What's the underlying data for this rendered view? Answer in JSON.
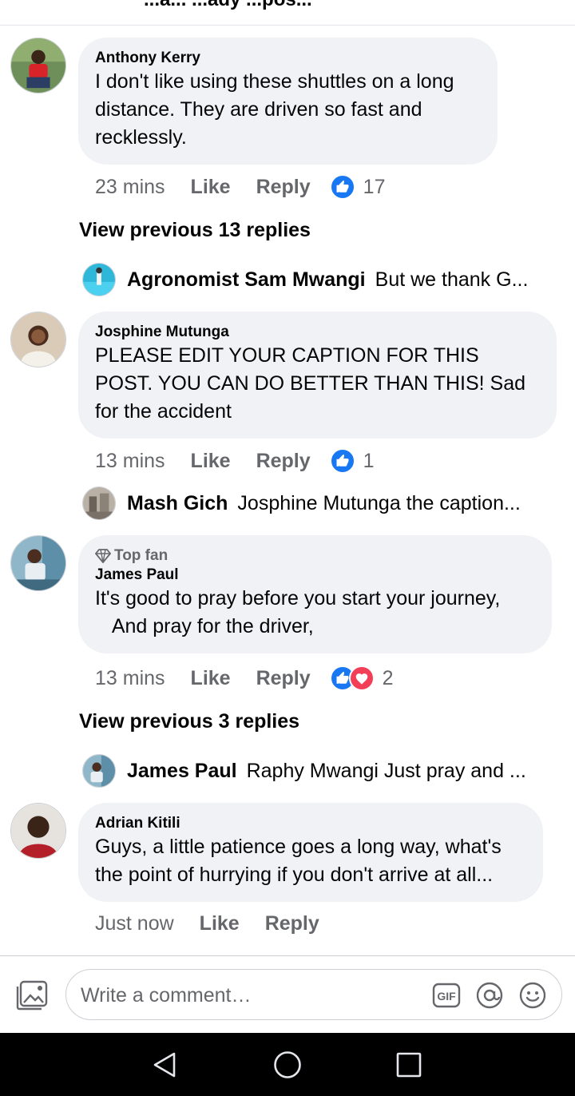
{
  "header": {
    "cut_title": "...a... ...ady ...pos..."
  },
  "comments": [
    {
      "author": "Anthony Kerry",
      "text": "I don't like using these shuttles on a long distance. They are driven so fast and recklessly.",
      "time": "23 mins",
      "like_label": "Like",
      "reply_label": "Reply",
      "reaction_count": "17",
      "reactions": [
        "like"
      ]
    },
    {
      "author": "Josphine Mutunga",
      "text": "PLEASE EDIT YOUR CAPTION FOR THIS POST. YOU CAN DO BETTER THAN THIS! Sad for the accident",
      "time": "13 mins",
      "like_label": "Like",
      "reply_label": "Reply",
      "reaction_count": "1",
      "reactions": [
        "like"
      ]
    },
    {
      "badge": "Top fan",
      "author": "James Paul",
      "text": "It's good to pray before you start your journey,\n   And pray for the driver,",
      "time": "13 mins",
      "like_label": "Like",
      "reply_label": "Reply",
      "reaction_count": "2",
      "reactions": [
        "like",
        "love"
      ]
    },
    {
      "author": "Adrian Kitili",
      "text": "Guys, a little patience goes a long way, what's the point of hurrying if you don't arrive at all...",
      "time": "Just now",
      "like_label": "Like",
      "reply_label": "Reply"
    }
  ],
  "view_previous": [
    {
      "label": "View previous 13 replies"
    },
    {
      "label": "View previous 3 replies"
    }
  ],
  "replies": [
    {
      "author": "Agronomist Sam Mwangi",
      "text": "But we thank G..."
    },
    {
      "author": "Mash Gich",
      "text": "Josphine Mutunga the caption..."
    },
    {
      "author": "James Paul",
      "text": "Raphy Mwangi Just pray and ..."
    }
  ],
  "composer": {
    "placeholder": "Write a comment…",
    "icons": [
      "photo-icon",
      "gif-icon",
      "mention-icon",
      "emoji-icon"
    ]
  },
  "navbar": {
    "icons": [
      "back-icon",
      "home-icon",
      "recents-icon"
    ]
  },
  "colors": {
    "bubble_bg": "#f0f2f5",
    "meta_text": "#65676b",
    "like_blue": "#1877f2",
    "love_red": "#f33e58"
  }
}
